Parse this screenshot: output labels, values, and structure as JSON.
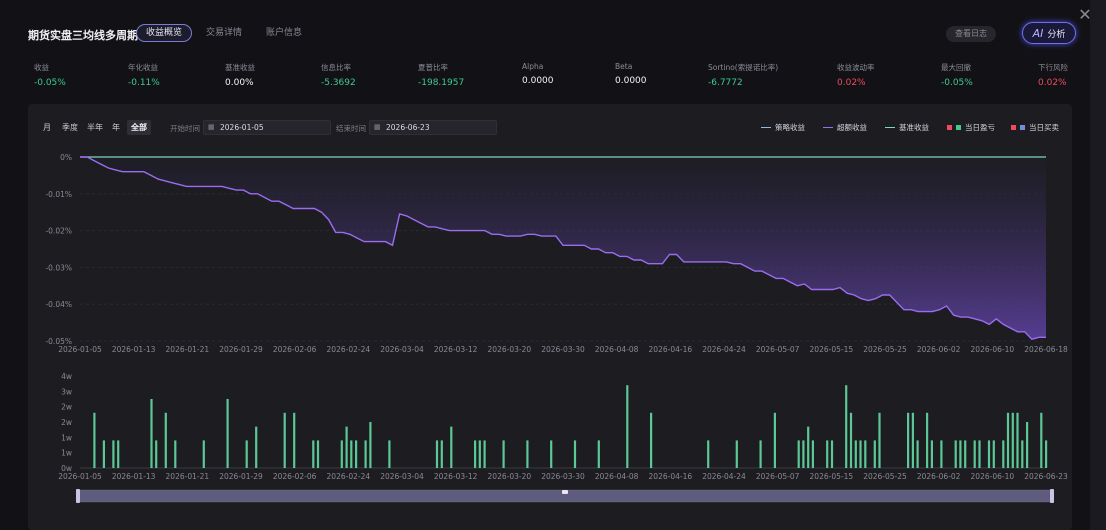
{
  "header": {
    "title": "期货实盘三均线多周期4_1",
    "tabs": [
      {
        "label": "收益概览",
        "active": true
      },
      {
        "label": "交易详情",
        "active": false
      },
      {
        "label": "账户信息",
        "active": false
      }
    ],
    "log_label": "查看日志",
    "ai_icon": "AI",
    "ai_label": "分析",
    "close_icon": "✕"
  },
  "metrics": [
    {
      "label": "收益",
      "value": "-0.05%",
      "tone": "pos"
    },
    {
      "label": "年化收益",
      "value": "-0.11%",
      "tone": "pos"
    },
    {
      "label": "基准收益",
      "value": "0.00%",
      "tone": "plain"
    },
    {
      "label": "信息比率",
      "value": "-5.3692",
      "tone": "pos"
    },
    {
      "label": "夏普比率",
      "value": "-198.1957",
      "tone": "pos"
    },
    {
      "label": "Alpha",
      "value": "0.0000",
      "tone": "plain"
    },
    {
      "label": "Beta",
      "value": "0.0000",
      "tone": "plain"
    },
    {
      "label": "Sortino(索提诺比率)",
      "value": "-6.7772",
      "tone": "pos"
    },
    {
      "label": "收益波动率",
      "value": "0.02%",
      "tone": "neg"
    },
    {
      "label": "最大回撤",
      "value": "-0.05%",
      "tone": "pos"
    },
    {
      "label": "下行风险",
      "value": "0.02%",
      "tone": "neg"
    }
  ],
  "toolbar": {
    "periods": [
      {
        "label": "月",
        "active": false
      },
      {
        "label": "季度",
        "active": false
      },
      {
        "label": "半年",
        "active": false
      },
      {
        "label": "年",
        "active": false
      },
      {
        "label": "全部",
        "active": true
      }
    ],
    "start_label": "开始时间",
    "start_value": "2026-01-05",
    "end_label": "结束时间",
    "end_value": "2026-06-23"
  },
  "legend": [
    {
      "label": "策略收益",
      "kind": "line",
      "color": "#8fb8e8"
    },
    {
      "label": "超额收益",
      "kind": "line",
      "color": "#9a6cf0"
    },
    {
      "label": "基准收益",
      "kind": "line",
      "color": "#7fd4c4"
    },
    {
      "label": "当日盈亏",
      "kind": "squares",
      "colors": [
        "#f04a5f",
        "#46c88e"
      ]
    },
    {
      "label": "当日买卖",
      "kind": "squares",
      "colors": [
        "#f04a5f",
        "#6f8fd8"
      ]
    }
  ],
  "colors": {
    "accent": "#9a6cf0",
    "positive": "#3dca8c",
    "negative": "#f04a5f",
    "bar": "#5cc896",
    "benchmark": "#7fd4c4"
  },
  "chart_data": [
    {
      "type": "line",
      "y_ticks": [
        "0%",
        "-0.01%",
        "-0.02%",
        "-0.03%",
        "-0.04%",
        "-0.05%"
      ],
      "ylim": [
        -0.05,
        0
      ],
      "x_ticks": [
        "2026-01-05",
        "2026-01-13",
        "2026-01-21",
        "2026-01-29",
        "2026-02-06",
        "2026-02-24",
        "2026-03-04",
        "2026-03-12",
        "2026-03-20",
        "2026-03-30",
        "2026-04-08",
        "2026-04-16",
        "2026-04-24",
        "2026-05-07",
        "2026-05-15",
        "2026-05-25",
        "2026-06-02",
        "2026-06-10",
        "2026-06-18"
      ],
      "series": [
        {
          "name": "超额收益",
          "values": [
            0,
            0,
            -0.001,
            -0.002,
            -0.003,
            -0.0035,
            -0.004,
            -0.004,
            -0.004,
            -0.004,
            -0.005,
            -0.006,
            -0.0065,
            -0.007,
            -0.0075,
            -0.008,
            -0.008,
            -0.008,
            -0.008,
            -0.008,
            -0.008,
            -0.0085,
            -0.009,
            -0.009,
            -0.01,
            -0.01,
            -0.011,
            -0.012,
            -0.012,
            -0.013,
            -0.014,
            -0.014,
            -0.014,
            -0.014,
            -0.015,
            -0.017,
            -0.0205,
            -0.0205,
            -0.021,
            -0.022,
            -0.023,
            -0.023,
            -0.023,
            -0.023,
            -0.024,
            -0.0155,
            -0.016,
            -0.017,
            -0.018,
            -0.019,
            -0.019,
            -0.0195,
            -0.02,
            -0.02,
            -0.02,
            -0.02,
            -0.02,
            -0.02,
            -0.021,
            -0.021,
            -0.0215,
            -0.0215,
            -0.0215,
            -0.021,
            -0.021,
            -0.0215,
            -0.0215,
            -0.0215,
            -0.024,
            -0.024,
            -0.024,
            -0.024,
            -0.025,
            -0.025,
            -0.026,
            -0.026,
            -0.027,
            -0.027,
            -0.028,
            -0.028,
            -0.029,
            -0.029,
            -0.029,
            -0.0265,
            -0.0265,
            -0.0285,
            -0.0285,
            -0.0285,
            -0.0285,
            -0.0285,
            -0.0285,
            -0.0285,
            -0.029,
            -0.029,
            -0.03,
            -0.031,
            -0.031,
            -0.032,
            -0.033,
            -0.033,
            -0.034,
            -0.035,
            -0.0345,
            -0.036,
            -0.036,
            -0.036,
            -0.036,
            -0.0355,
            -0.037,
            -0.0375,
            -0.0385,
            -0.039,
            -0.0385,
            -0.0375,
            -0.0375,
            -0.0395,
            -0.0415,
            -0.0415,
            -0.042,
            -0.042,
            -0.042,
            -0.0415,
            -0.0405,
            -0.043,
            -0.0435,
            -0.0435,
            -0.044,
            -0.0445,
            -0.0455,
            -0.044,
            -0.0455,
            -0.0465,
            -0.0475,
            -0.0475,
            -0.0495,
            -0.049,
            -0.049
          ]
        },
        {
          "name": "基准收益",
          "values": [
            0,
            0
          ]
        }
      ]
    },
    {
      "type": "bar",
      "y_ticks": [
        "4w",
        "3w",
        "2w",
        "2w",
        "1w",
        "1w",
        "0w"
      ],
      "ylim": [
        0,
        4
      ],
      "x_ticks": [
        "2026-01-05",
        "2026-01-13",
        "2026-01-21",
        "2026-01-29",
        "2026-02-06",
        "2026-02-24",
        "2026-03-04",
        "2026-03-12",
        "2026-03-20",
        "2026-03-30",
        "2026-04-08",
        "2026-04-16",
        "2026-04-24",
        "2026-05-07",
        "2026-05-15",
        "2026-05-25",
        "2026-06-02",
        "2026-06-10",
        "2026-06-23"
      ],
      "values": [
        0,
        0,
        0,
        2.4,
        0,
        1.2,
        0,
        1.2,
        1.2,
        0,
        0,
        0,
        0,
        0,
        0,
        3.0,
        1.2,
        0,
        2.4,
        0,
        1.2,
        0,
        0,
        0,
        0,
        0,
        1.2,
        0,
        0,
        0,
        0,
        3.0,
        0,
        0,
        0,
        1.2,
        0,
        1.8,
        0,
        0,
        0,
        0,
        0,
        2.4,
        0,
        2.4,
        0,
        0,
        0,
        1.2,
        1.2,
        0,
        0,
        0,
        0,
        1.2,
        1.8,
        1.2,
        1.2,
        0,
        1.2,
        2.0,
        0,
        0,
        0,
        1.2,
        0,
        0,
        0,
        0,
        0,
        0,
        0,
        0,
        0,
        1.2,
        1.2,
        0,
        1.8,
        0,
        0,
        0,
        0,
        1.2,
        1.2,
        1.2,
        0,
        0,
        0,
        1.2,
        0,
        0,
        0,
        0,
        1.2,
        0,
        0,
        0,
        0,
        1.2,
        0,
        0,
        0,
        0,
        1.2,
        0,
        0,
        0,
        0,
        1.2,
        0,
        0,
        0,
        0,
        0,
        3.6,
        0,
        0,
        0,
        0,
        2.4,
        0,
        0,
        0,
        0,
        0,
        0,
        0,
        0,
        0,
        0,
        0,
        1.2,
        0,
        0,
        0,
        0,
        0,
        1.2,
        0,
        0,
        0,
        0,
        1.2,
        0,
        0,
        2.4,
        0,
        0,
        0,
        0,
        1.2,
        1.2,
        1.8,
        1.2,
        0,
        0,
        1.2,
        1.2,
        0,
        0,
        3.6,
        2.4,
        1.2,
        1.2,
        1.2,
        0,
        1.2,
        2.4,
        0,
        0,
        0,
        0,
        0,
        2.4,
        2.4,
        1.2,
        0,
        2.4,
        1.2,
        0,
        1.2,
        0,
        0,
        1.2,
        1.2,
        1.2,
        0,
        1.2,
        1.2,
        0,
        1.2,
        1.2,
        0,
        1.2,
        2.4,
        2.4,
        2.4,
        1.2,
        2.0,
        0,
        0,
        2.4,
        1.2
      ]
    }
  ]
}
